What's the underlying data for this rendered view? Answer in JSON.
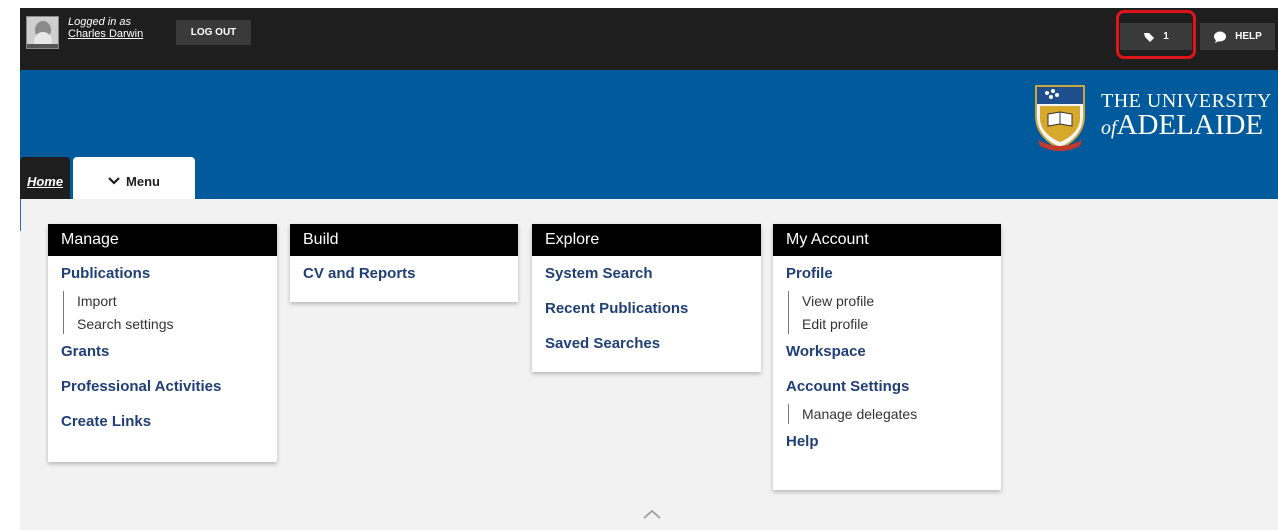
{
  "user": {
    "logged_in_label": "Logged in as",
    "name": "Charles Darwin",
    "logout_label": "LOG OUT"
  },
  "toolbar": {
    "tasks_count": "1",
    "help_label": "HELP"
  },
  "brand": {
    "line1": "THE UNIVERSITY",
    "line2_of": "of",
    "line2_name": "ADELAIDE"
  },
  "tabs": {
    "home": "Home",
    "menu": "Menu"
  },
  "panels": {
    "manage": {
      "title": "Manage",
      "publications": "Publications",
      "publications_sub": [
        "Import",
        "Search settings"
      ],
      "grants": "Grants",
      "professional_activities": "Professional Activities",
      "create_links": "Create Links"
    },
    "build": {
      "title": "Build",
      "cv_reports": "CV and Reports"
    },
    "explore": {
      "title": "Explore",
      "system_search": "System Search",
      "recent_publications": "Recent Publications",
      "saved_searches": "Saved Searches"
    },
    "account": {
      "title": "My Account",
      "profile": "Profile",
      "profile_sub": [
        "View profile",
        "Edit profile"
      ],
      "workspace": "Workspace",
      "account_settings": "Account Settings",
      "account_settings_sub": [
        "Manage delegates"
      ],
      "help": "Help"
    }
  },
  "colors": {
    "topbar": "#1e1e1e",
    "banner": "#005a9c",
    "link": "#1f3f76",
    "highlight": "#e0151c"
  }
}
